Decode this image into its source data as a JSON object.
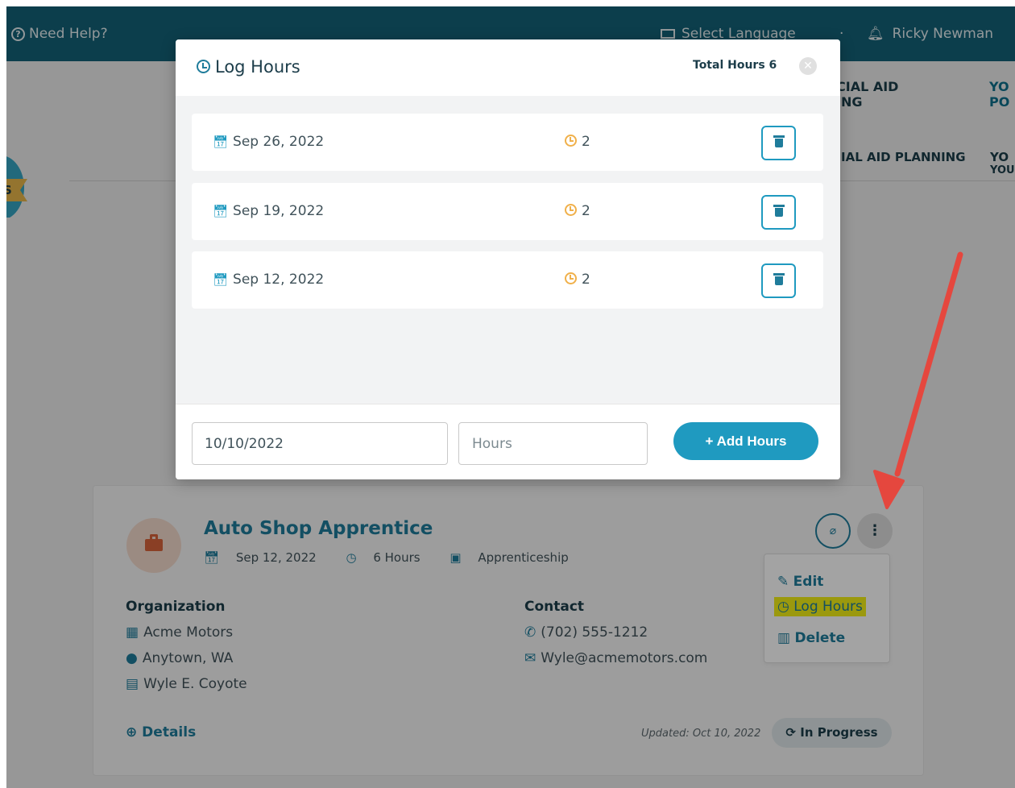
{
  "topbar": {
    "help": "Need Help?",
    "language": "Select Language",
    "separator": "·",
    "user": "Ricky Newman"
  },
  "nav": {
    "ribbon": "S",
    "item1_line1": "CIAL AID",
    "item1_line2": "ING",
    "item2_line1": "YO",
    "item2_line2": "PO",
    "sub1": "IAL AID PLANNING",
    "sub2_line1": "YO",
    "sub2_line2": "YOU"
  },
  "card": {
    "title": "Auto Shop Apprentice",
    "date": "Sep 12, 2022",
    "hours": "6 Hours",
    "type": "Apprenticeship",
    "organization_heading": "Organization",
    "organization": "Acme Motors",
    "location": "Anytown, WA",
    "person": "Wyle E. Coyote",
    "contact_heading": "Contact",
    "phone": "(702) 555-1212",
    "email": "Wyle@acmemotors.com",
    "details": "Details",
    "updated": "Updated: Oct 10, 2022",
    "status": "In Progress"
  },
  "menu": {
    "edit": "Edit",
    "log_hours": "Log Hours",
    "delete": "Delete"
  },
  "modal": {
    "title": "Log Hours",
    "total": "Total Hours 6",
    "entries": [
      {
        "date": "Sep 26, 2022",
        "hours": "2"
      },
      {
        "date": "Sep 19, 2022",
        "hours": "2"
      },
      {
        "date": "Sep 12, 2022",
        "hours": "2"
      }
    ],
    "date_value": "10/10/2022",
    "hours_placeholder": "Hours",
    "add_label": "+ Add Hours"
  },
  "colors": {
    "topbar": "#146277",
    "accent": "#1f9ac0",
    "highlight": "#f3ef16",
    "arrow": "#e5473e"
  }
}
